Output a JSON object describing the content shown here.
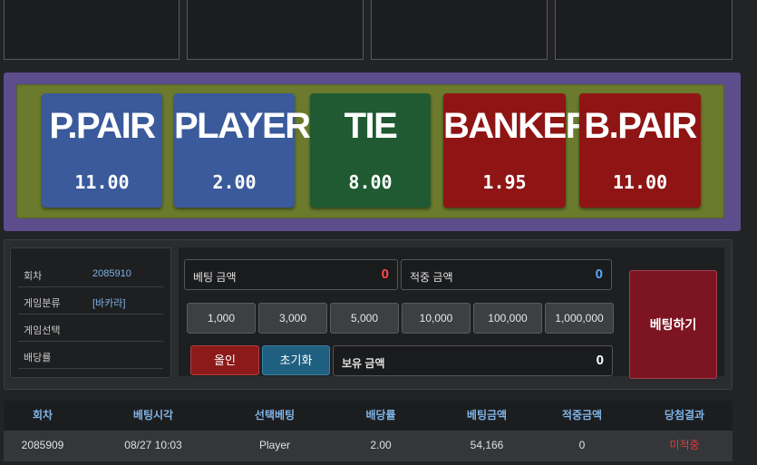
{
  "bets": [
    {
      "name": "P.PAIR",
      "odds": "11.00",
      "color": "#3a5a9b"
    },
    {
      "name": "PLAYER",
      "odds": "2.00",
      "color": "#3a5a9b"
    },
    {
      "name": "TIE",
      "odds": "8.00",
      "color": "#1f5a32"
    },
    {
      "name": "BANKER",
      "odds": "1.95",
      "color": "#8f1515"
    },
    {
      "name": "B.PAIR",
      "odds": "11.00",
      "color": "#8f1515"
    }
  ],
  "info": {
    "round_label": "회차",
    "round_value": "2085910",
    "category_label": "게임분류",
    "category_value": "[바카라]",
    "select_label": "게임선택",
    "select_value": "",
    "odds_label": "배당률",
    "odds_value": ""
  },
  "bet_form": {
    "bet_amount_label": "베팅 금액",
    "bet_amount_value": "0",
    "win_amount_label": "적중 금액",
    "win_amount_value": "0",
    "balance_label": "보유 금액",
    "balance_value": "0",
    "chips": [
      "1,000",
      "3,000",
      "5,000",
      "10,000",
      "100,000",
      "1,000,000"
    ],
    "allin_label": "올인",
    "reset_label": "초기화",
    "bet_button_label": "베팅하기",
    "accent_red": "#ff4a4a",
    "accent_blue": "#5aa7ff"
  },
  "history": {
    "headers": [
      "회차",
      "베팅시각",
      "선택베팅",
      "배당률",
      "베팅금액",
      "적중금액",
      "당첨결과"
    ],
    "rows": [
      [
        "2085909",
        "08/27 10:03",
        "Player",
        "2.00",
        "54,166",
        "0",
        "미적중"
      ]
    ],
    "miss_color": "#e03a3a"
  }
}
